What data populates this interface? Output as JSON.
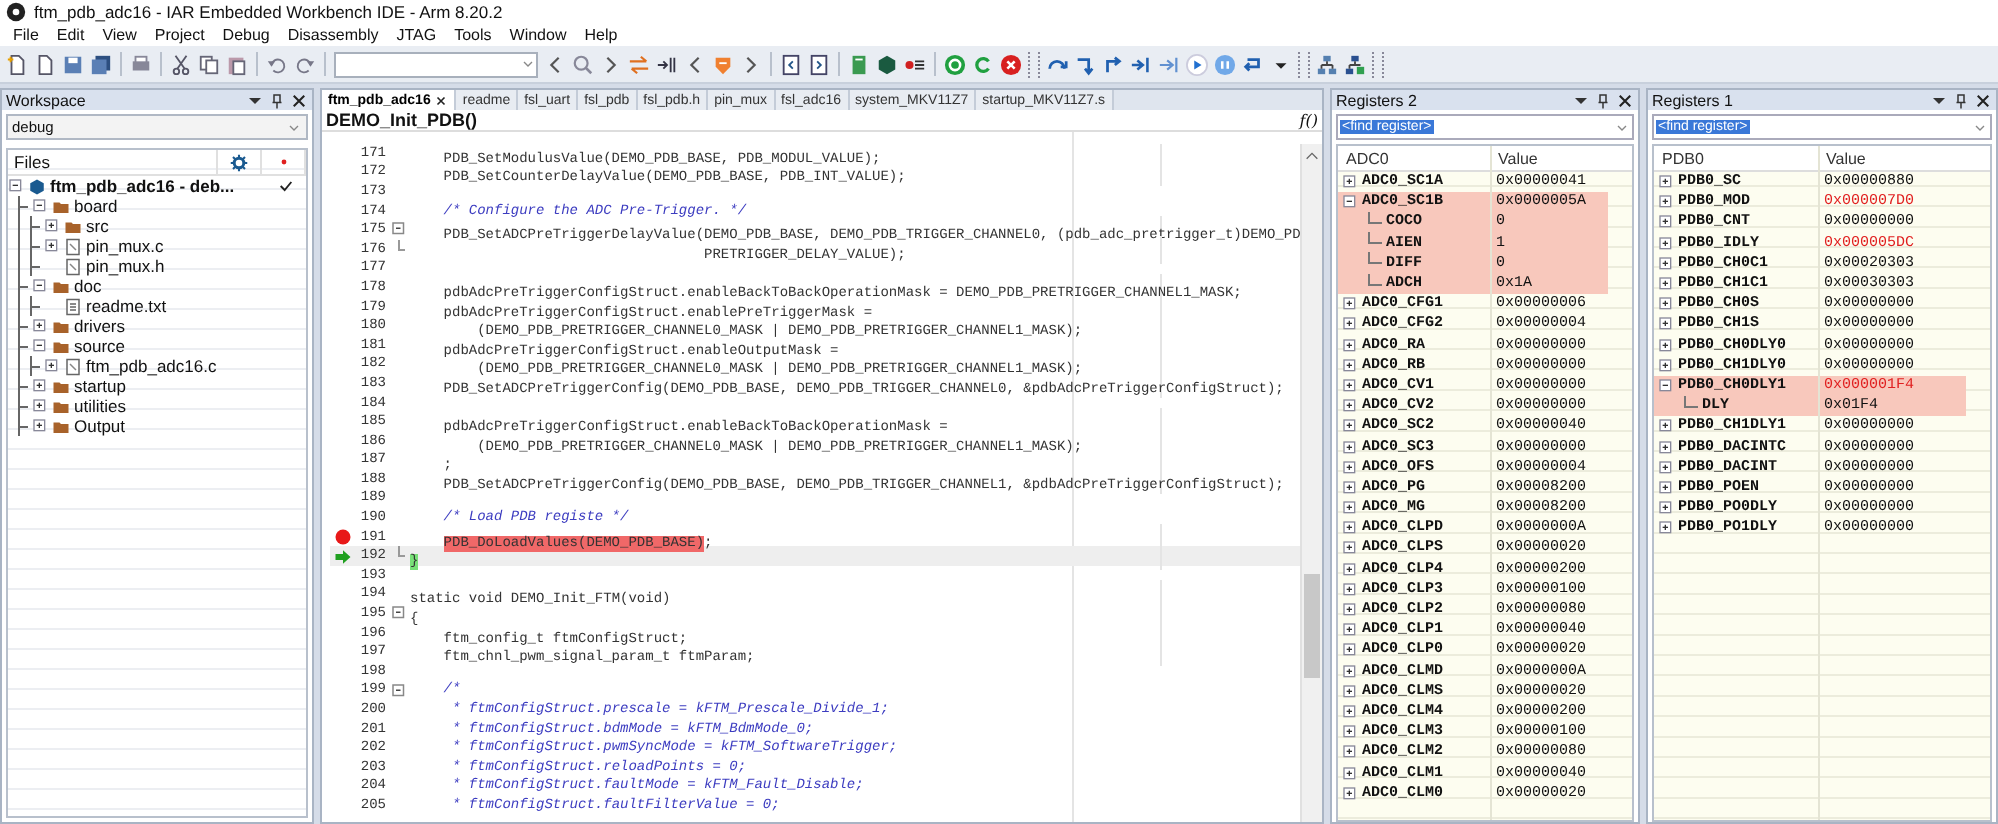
{
  "window": {
    "title": "ftm_pdb_adc16 - IAR Embedded Workbench IDE - Arm 8.20.2"
  },
  "menu": [
    "File",
    "Edit",
    "View",
    "Project",
    "Debug",
    "Disassembly",
    "JTAG",
    "Tools",
    "Window",
    "Help"
  ],
  "workspace": {
    "title": "Workspace",
    "configuration": "debug",
    "files_header": "Files",
    "tree": [
      {
        "label": "ftm_pdb_adc16 - deb...",
        "kind": "project",
        "expanded": true,
        "checked": true,
        "children": [
          {
            "label": "board",
            "kind": "folder",
            "expanded": true,
            "children": [
              {
                "label": "src",
                "kind": "folder",
                "expanded": false
              },
              {
                "label": "pin_mux.c",
                "kind": "source",
                "expanded": false
              },
              {
                "label": "pin_mux.h",
                "kind": "source"
              }
            ]
          },
          {
            "label": "doc",
            "kind": "folder",
            "expanded": true,
            "children": [
              {
                "label": "readme.txt",
                "kind": "text"
              }
            ]
          },
          {
            "label": "drivers",
            "kind": "folder",
            "expanded": false
          },
          {
            "label": "source",
            "kind": "folder",
            "expanded": true,
            "children": [
              {
                "label": "ftm_pdb_adc16.c",
                "kind": "source",
                "expanded": false
              }
            ]
          },
          {
            "label": "startup",
            "kind": "folder",
            "expanded": false
          },
          {
            "label": "utilities",
            "kind": "folder",
            "expanded": false
          },
          {
            "label": "Output",
            "kind": "folder",
            "expanded": false
          }
        ]
      }
    ]
  },
  "editor": {
    "tabs": [
      {
        "label": "ftm_pdb_adc16",
        "selected": true
      },
      {
        "label": "readme",
        "selected": false
      },
      {
        "label": "fsl_uart",
        "selected": false
      },
      {
        "label": "fsl_pdb",
        "selected": false
      },
      {
        "label": "fsl_pdb.h",
        "selected": false
      },
      {
        "label": "pin_mux",
        "selected": false
      },
      {
        "label": "fsl_adc16",
        "selected": false
      },
      {
        "label": "system_MKV11Z7",
        "selected": false
      },
      {
        "label": "startup_MKV11Z7.s",
        "selected": false
      }
    ],
    "function": "DEMO_Init_PDB()",
    "function_button": "f()",
    "lines": [
      {
        "num": "171",
        "kind": "code",
        "text": "    PDB_SetModulusValue(DEMO_PDB_BASE, PDB_MODUL_VALUE);",
        "breakpoint": false,
        "current": false,
        "fold_start": false,
        "fold_end": false
      },
      {
        "num": "172",
        "kind": "code",
        "text": "    PDB_SetCounterDelayValue(DEMO_PDB_BASE, PDB_INT_VALUE);",
        "breakpoint": false,
        "current": false,
        "fold_start": false,
        "fold_end": false
      },
      {
        "num": "173",
        "breakpoint": false,
        "current": false,
        "fold_start": false,
        "fold_end": false
      },
      {
        "num": "174",
        "kind": "comment",
        "text": "    /* Configure the ADC Pre-Trigger. */",
        "breakpoint": false,
        "current": false,
        "fold_start": false,
        "fold_end": false
      },
      {
        "num": "175",
        "kind": "code",
        "text": "    PDB_SetADCPreTriggerDelayValue(DEMO_PDB_BASE, DEMO_PDB_TRIGGER_CHANNEL0, (pdb_adc_pretrigger_t)DEMO_PD",
        "breakpoint": false,
        "current": false,
        "fold_start": true,
        "fold_end": false
      },
      {
        "num": "176",
        "kind": "code",
        "text": "                                   PRETRIGGER_DELAY_VALUE);",
        "breakpoint": false,
        "current": false,
        "fold_start": false,
        "fold_end": true
      },
      {
        "num": "177",
        "breakpoint": false,
        "current": false,
        "fold_start": false,
        "fold_end": false
      },
      {
        "num": "178",
        "kind": "code",
        "text": "    pdbAdcPreTriggerConfigStruct.enableBackToBackOperationMask = DEMO_PDB_PRETRIGGER_CHANNEL1_MASK;",
        "breakpoint": false,
        "current": false,
        "fold_start": false,
        "fold_end": false
      },
      {
        "num": "179",
        "kind": "code",
        "text": "    pdbAdcPreTriggerConfigStruct.enablePreTriggerMask =",
        "breakpoint": false,
        "current": false,
        "fold_start": false,
        "fold_end": false
      },
      {
        "num": "180",
        "kind": "code",
        "text": "        (DEMO_PDB_PRETRIGGER_CHANNEL0_MASK | DEMO_PDB_PRETRIGGER_CHANNEL1_MASK);",
        "breakpoint": false,
        "current": false,
        "fold_start": false,
        "fold_end": false
      },
      {
        "num": "181",
        "kind": "code",
        "text": "    pdbAdcPreTriggerConfigStruct.enableOutputMask =",
        "breakpoint": false,
        "current": false,
        "fold_start": false,
        "fold_end": false
      },
      {
        "num": "182",
        "kind": "code",
        "text": "        (DEMO_PDB_PRETRIGGER_CHANNEL0_MASK | DEMO_PDB_PRETRIGGER_CHANNEL1_MASK);",
        "breakpoint": false,
        "current": false,
        "fold_start": false,
        "fold_end": false
      },
      {
        "num": "183",
        "kind": "code",
        "text": "    PDB_SetADCPreTriggerConfig(DEMO_PDB_BASE, DEMO_PDB_TRIGGER_CHANNEL0, &pdbAdcPreTriggerConfigStruct);",
        "breakpoint": false,
        "current": false,
        "fold_start": false,
        "fold_end": false
      },
      {
        "num": "184",
        "breakpoint": false,
        "current": false,
        "fold_start": false,
        "fold_end": false
      },
      {
        "num": "185",
        "kind": "code",
        "text": "    pdbAdcPreTriggerConfigStruct.enableBackToBackOperationMask =",
        "breakpoint": false,
        "current": false,
        "fold_start": false,
        "fold_end": false
      },
      {
        "num": "186",
        "kind": "code",
        "text": "        (DEMO_PDB_PRETRIGGER_CHANNEL0_MASK | DEMO_PDB_PRETRIGGER_CHANNEL1_MASK);",
        "breakpoint": false,
        "current": false,
        "fold_start": false,
        "fold_end": false
      },
      {
        "num": "187",
        "kind": "code",
        "text": "    ;",
        "breakpoint": false,
        "current": false,
        "fold_start": false,
        "fold_end": false
      },
      {
        "num": "188",
        "kind": "code",
        "text": "    PDB_SetADCPreTriggerConfig(DEMO_PDB_BASE, DEMO_PDB_TRIGGER_CHANNEL1, &pdbAdcPreTriggerConfigStruct);",
        "breakpoint": false,
        "current": false,
        "fold_start": false,
        "fold_end": false
      },
      {
        "num": "189",
        "breakpoint": false,
        "current": false,
        "fold_start": false,
        "fold_end": false
      },
      {
        "num": "190",
        "kind": "comment",
        "text": "    /* Load PDB registe */",
        "breakpoint": false,
        "current": false,
        "fold_start": false,
        "fold_end": false
      },
      {
        "num": "191",
        "kind": "code",
        "text": "    PDB_DoLoadValues(DEMO_PDB_BASE)",
        "tail": ";",
        "breakpoint": true,
        "current": false,
        "fold_start": false,
        "fold_end": false
      },
      {
        "num": "192",
        "kind": "code",
        "text": "}",
        "breakpoint": false,
        "current": true,
        "fold_start": false,
        "fold_end": true
      },
      {
        "num": "193",
        "breakpoint": false,
        "current": false,
        "fold_start": false,
        "fold_end": false
      },
      {
        "num": "194",
        "kind": "code",
        "text": "static void DEMO_Init_FTM(void)",
        "breakpoint": false,
        "current": false,
        "fold_start": false,
        "fold_end": false
      },
      {
        "num": "195",
        "kind": "code",
        "text": "{",
        "breakpoint": false,
        "current": false,
        "fold_start": true,
        "fold_end": false
      },
      {
        "num": "196",
        "kind": "code",
        "text": "    ftm_config_t ftmConfigStruct;",
        "breakpoint": false,
        "current": false,
        "fold_start": false,
        "fold_end": false
      },
      {
        "num": "197",
        "kind": "code",
        "text": "    ftm_chnl_pwm_signal_param_t ftmParam;",
        "breakpoint": false,
        "current": false,
        "fold_start": false,
        "fold_end": false
      },
      {
        "num": "198",
        "breakpoint": false,
        "current": false,
        "fold_start": false,
        "fold_end": false
      },
      {
        "num": "199",
        "kind": "comment",
        "text": "    /*",
        "breakpoint": false,
        "current": false,
        "fold_start": true,
        "fold_end": false
      },
      {
        "num": "200",
        "kind": "comment",
        "text": "     * ftmConfigStruct.prescale = kFTM_Prescale_Divide_1;",
        "breakpoint": false,
        "current": false,
        "fold_start": false,
        "fold_end": false
      },
      {
        "num": "201",
        "kind": "comment",
        "text": "     * ftmConfigStruct.bdmMode = kFTM_BdmMode_0;",
        "breakpoint": false,
        "current": false,
        "fold_start": false,
        "fold_end": false
      },
      {
        "num": "202",
        "kind": "comment",
        "text": "     * ftmConfigStruct.pwmSyncMode = kFTM_SoftwareTrigger;",
        "breakpoint": false,
        "current": false,
        "fold_start": false,
        "fold_end": false
      },
      {
        "num": "203",
        "kind": "comment",
        "text": "     * ftmConfigStruct.reloadPoints = 0;",
        "breakpoint": false,
        "current": false,
        "fold_start": false,
        "fold_end": false
      },
      {
        "num": "204",
        "kind": "comment",
        "text": "     * ftmConfigStruct.faultMode = kFTM_Fault_Disable;",
        "breakpoint": false,
        "current": false,
        "fold_start": false,
        "fold_end": false
      },
      {
        "num": "205",
        "kind": "comment",
        "text": "     * ftmConfigStruct.faultFilterValue = 0;",
        "breakpoint": false,
        "current": false,
        "fold_start": false,
        "fold_end": false
      }
    ]
  },
  "registers_2": {
    "title": "Registers 2",
    "find_field": "<find register>",
    "columns": [
      "ADC0",
      "Value"
    ],
    "rows": [
      {
        "name": "ADC0_SC1A",
        "value": "0x00000041",
        "expanded": false,
        "changed": false
      },
      {
        "name": "ADC0_SC1B",
        "value": "0x0000005A",
        "expanded": true,
        "changed": false,
        "children": [
          {
            "name": "COCO",
            "value": "0",
            "changed": false
          },
          {
            "name": "AIEN",
            "value": "1",
            "changed": false
          },
          {
            "name": "DIFF",
            "value": "0",
            "changed": false
          },
          {
            "name": "ADCH",
            "value": "0x1A",
            "changed": false
          }
        ]
      },
      {
        "name": "ADC0_CFG1",
        "value": "0x00000006",
        "expanded": false,
        "changed": false
      },
      {
        "name": "ADC0_CFG2",
        "value": "0x00000004",
        "expanded": false,
        "changed": false
      },
      {
        "name": "ADC0_RA",
        "value": "0x00000000",
        "expanded": false,
        "changed": false
      },
      {
        "name": "ADC0_RB",
        "value": "0x00000000",
        "expanded": false,
        "changed": false
      },
      {
        "name": "ADC0_CV1",
        "value": "0x00000000",
        "expanded": false,
        "changed": false
      },
      {
        "name": "ADC0_CV2",
        "value": "0x00000000",
        "expanded": false,
        "changed": false
      },
      {
        "name": "ADC0_SC2",
        "value": "0x00000040",
        "expanded": false,
        "changed": false
      },
      {
        "name": "ADC0_SC3",
        "value": "0x00000000",
        "expanded": false,
        "changed": false
      },
      {
        "name": "ADC0_OFS",
        "value": "0x00000004",
        "expanded": false,
        "changed": false
      },
      {
        "name": "ADC0_PG",
        "value": "0x00008200",
        "expanded": false,
        "changed": false
      },
      {
        "name": "ADC0_MG",
        "value": "0x00008200",
        "expanded": false,
        "changed": false
      },
      {
        "name": "ADC0_CLPD",
        "value": "0x0000000A",
        "expanded": false,
        "changed": false
      },
      {
        "name": "ADC0_CLPS",
        "value": "0x00000020",
        "expanded": false,
        "changed": false
      },
      {
        "name": "ADC0_CLP4",
        "value": "0x00000200",
        "expanded": false,
        "changed": false
      },
      {
        "name": "ADC0_CLP3",
        "value": "0x00000100",
        "expanded": false,
        "changed": false
      },
      {
        "name": "ADC0_CLP2",
        "value": "0x00000080",
        "expanded": false,
        "changed": false
      },
      {
        "name": "ADC0_CLP1",
        "value": "0x00000040",
        "expanded": false,
        "changed": false
      },
      {
        "name": "ADC0_CLP0",
        "value": "0x00000020",
        "expanded": false,
        "changed": false
      },
      {
        "name": "ADC0_CLMD",
        "value": "0x0000000A",
        "expanded": false,
        "changed": false
      },
      {
        "name": "ADC0_CLMS",
        "value": "0x00000020",
        "expanded": false,
        "changed": false
      },
      {
        "name": "ADC0_CLM4",
        "value": "0x00000200",
        "expanded": false,
        "changed": false
      },
      {
        "name": "ADC0_CLM3",
        "value": "0x00000100",
        "expanded": false,
        "changed": false
      },
      {
        "name": "ADC0_CLM2",
        "value": "0x00000080",
        "expanded": false,
        "changed": false
      },
      {
        "name": "ADC0_CLM1",
        "value": "0x00000040",
        "expanded": false,
        "changed": false
      },
      {
        "name": "ADC0_CLM0",
        "value": "0x00000020",
        "expanded": false,
        "changed": false
      }
    ]
  },
  "registers_1": {
    "title": "Registers 1",
    "find_field": "<find register>",
    "columns": [
      "PDB0",
      "Value"
    ],
    "rows": [
      {
        "name": "PDB0_SC",
        "value": "0x00000880",
        "expanded": false,
        "changed": false
      },
      {
        "name": "PDB0_MOD",
        "value": "0x000007D0",
        "expanded": false,
        "changed": true
      },
      {
        "name": "PDB0_CNT",
        "value": "0x00000000",
        "expanded": false,
        "changed": false
      },
      {
        "name": "PDB0_IDLY",
        "value": "0x000005DC",
        "expanded": false,
        "changed": true
      },
      {
        "name": "PDB0_CH0C1",
        "value": "0x00020303",
        "expanded": false,
        "changed": false
      },
      {
        "name": "PDB0_CH1C1",
        "value": "0x00030303",
        "expanded": false,
        "changed": false
      },
      {
        "name": "PDB0_CH0S",
        "value": "0x00000000",
        "expanded": false,
        "changed": false
      },
      {
        "name": "PDB0_CH1S",
        "value": "0x00000000",
        "expanded": false,
        "changed": false
      },
      {
        "name": "PDB0_CH0DLY0",
        "value": "0x00000000",
        "expanded": false,
        "changed": false
      },
      {
        "name": "PDB0_CH1DLY0",
        "value": "0x00000000",
        "expanded": false,
        "changed": false
      },
      {
        "name": "PDB0_CH0DLY1",
        "value": "0x000001F4",
        "expanded": true,
        "changed": true,
        "children": [
          {
            "name": "DLY",
            "value": "0x01F4",
            "changed": false
          }
        ]
      },
      {
        "name": "PDB0_CH1DLY1",
        "value": "0x00000000",
        "expanded": false,
        "changed": false
      },
      {
        "name": "PDB0_DACINTC",
        "value": "0x00000000",
        "expanded": false,
        "changed": false
      },
      {
        "name": "PDB0_DACINT",
        "value": "0x00000000",
        "expanded": false,
        "changed": false
      },
      {
        "name": "PDB0_POEN",
        "value": "0x00000000",
        "expanded": false,
        "changed": false
      },
      {
        "name": "PDB0_PO0DLY",
        "value": "0x00000000",
        "expanded": false,
        "changed": false
      },
      {
        "name": "PDB0_PO1DLY",
        "value": "0x00000000",
        "expanded": false,
        "changed": false
      }
    ]
  }
}
